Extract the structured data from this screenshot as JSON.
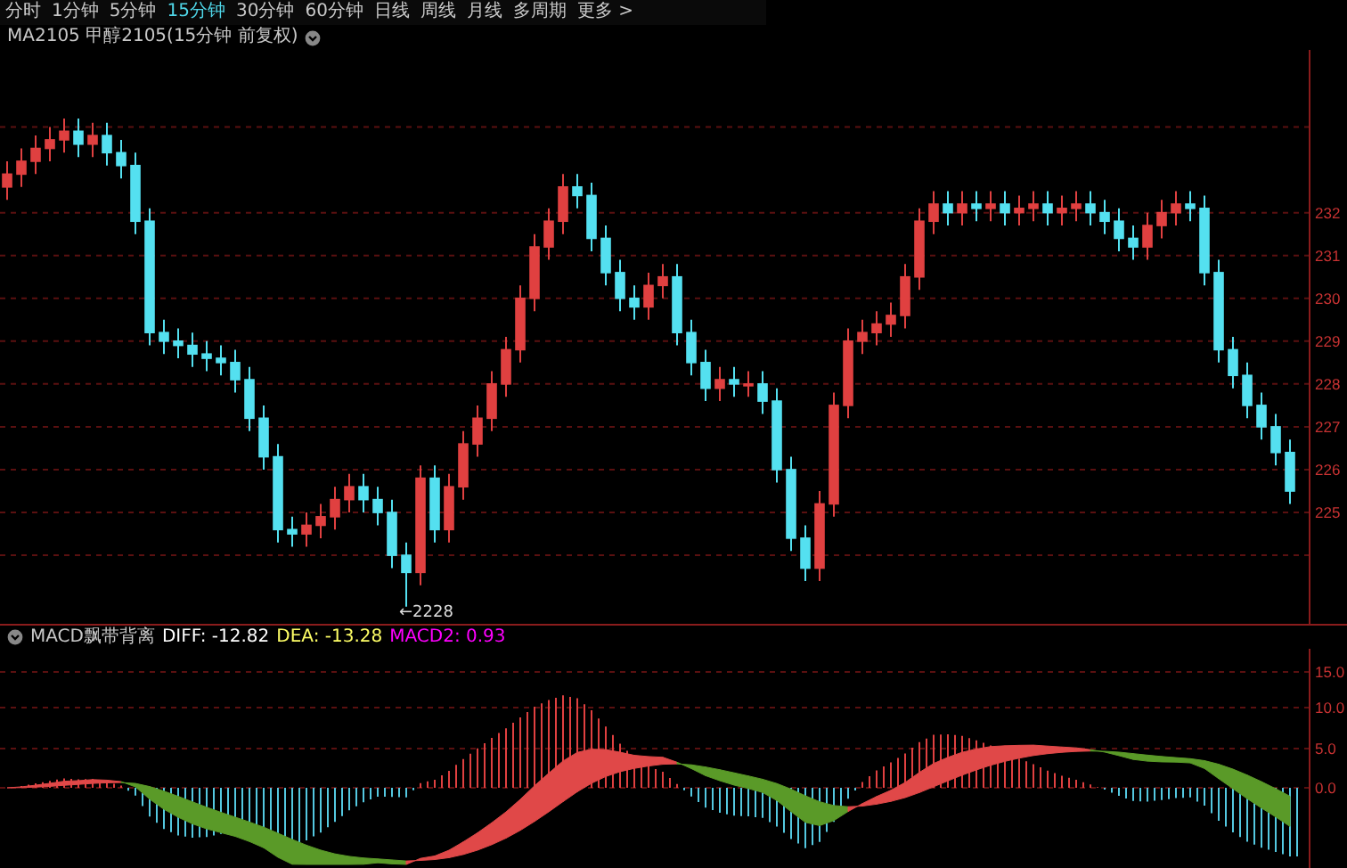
{
  "toolbar": {
    "tabs": [
      {
        "label": "分时",
        "selected": false
      },
      {
        "label": "1分钟",
        "selected": false
      },
      {
        "label": "5分钟",
        "selected": false
      },
      {
        "label": "15分钟",
        "selected": true
      },
      {
        "label": "30分钟",
        "selected": false
      },
      {
        "label": "60分钟",
        "selected": false
      },
      {
        "label": "日线",
        "selected": false
      },
      {
        "label": "周线",
        "selected": false
      },
      {
        "label": "月线",
        "selected": false
      },
      {
        "label": "多周期",
        "selected": false
      },
      {
        "label": "更多 >",
        "selected": false
      }
    ]
  },
  "title": "MA2105 甲醇2105(15分钟 前复权)",
  "price_chart": {
    "low_marker": "←2228",
    "chart_data": {
      "type": "candlestick",
      "ylim": [
        222.4,
        235.8
      ],
      "grid": true,
      "yticks": [
        232,
        231,
        230,
        229,
        228,
        227,
        226,
        225
      ],
      "categories": [
        null,
        null,
        null,
        null,
        null,
        null,
        null,
        null,
        null,
        null,
        null,
        null,
        null,
        null,
        null,
        null,
        null,
        null,
        null,
        null,
        null,
        null,
        null,
        null,
        null,
        null,
        null,
        null,
        null,
        null,
        null,
        null,
        null,
        null,
        null,
        null,
        null,
        null,
        null,
        null,
        null,
        null,
        null,
        null,
        null,
        null,
        null,
        null,
        null,
        null,
        null,
        null,
        null,
        null,
        null,
        null,
        null,
        null,
        null,
        null,
        null,
        null,
        null,
        null,
        null,
        null,
        null,
        null,
        null,
        null,
        null,
        null,
        null,
        null,
        null,
        null,
        null,
        null,
        null,
        null,
        null,
        null,
        null,
        null,
        null,
        null,
        null,
        null,
        null,
        null,
        null
      ],
      "ohlc": [
        [
          232.6,
          233.2,
          232.3,
          232.9
        ],
        [
          232.9,
          233.5,
          232.6,
          233.2
        ],
        [
          233.2,
          233.8,
          232.9,
          233.5
        ],
        [
          233.5,
          234.0,
          233.2,
          233.7
        ],
        [
          233.7,
          234.2,
          233.4,
          233.9
        ],
        [
          233.9,
          234.2,
          233.3,
          233.6
        ],
        [
          233.6,
          234.1,
          233.3,
          233.8
        ],
        [
          233.8,
          234.1,
          233.1,
          233.4
        ],
        [
          233.4,
          233.7,
          232.8,
          233.1
        ],
        [
          233.1,
          233.4,
          231.5,
          231.8
        ],
        [
          231.8,
          232.1,
          228.9,
          229.2
        ],
        [
          229.2,
          229.5,
          228.7,
          229.0
        ],
        [
          229.0,
          229.3,
          228.6,
          228.9
        ],
        [
          228.9,
          229.2,
          228.4,
          228.7
        ],
        [
          228.7,
          229.0,
          228.3,
          228.6
        ],
        [
          228.6,
          228.9,
          228.2,
          228.5
        ],
        [
          228.5,
          228.8,
          227.8,
          228.1
        ],
        [
          228.1,
          228.4,
          226.9,
          227.2
        ],
        [
          227.2,
          227.5,
          226.0,
          226.3
        ],
        [
          226.3,
          226.6,
          224.3,
          224.6
        ],
        [
          224.6,
          224.9,
          224.2,
          224.5
        ],
        [
          224.5,
          225.0,
          224.2,
          224.7
        ],
        [
          224.7,
          225.2,
          224.4,
          224.9
        ],
        [
          224.9,
          225.6,
          224.6,
          225.3
        ],
        [
          225.3,
          225.9,
          225.0,
          225.6
        ],
        [
          225.6,
          225.9,
          225.0,
          225.3
        ],
        [
          225.3,
          225.6,
          224.7,
          225.0
        ],
        [
          225.0,
          225.3,
          223.7,
          224.0
        ],
        [
          224.0,
          224.3,
          222.8,
          223.6
        ],
        [
          223.6,
          226.1,
          223.3,
          225.8
        ],
        [
          225.8,
          226.1,
          224.3,
          224.6
        ],
        [
          224.6,
          225.9,
          224.3,
          225.6
        ],
        [
          225.6,
          226.9,
          225.3,
          226.6
        ],
        [
          226.6,
          227.5,
          226.3,
          227.2
        ],
        [
          227.2,
          228.3,
          226.9,
          228.0
        ],
        [
          228.0,
          229.1,
          227.7,
          228.8
        ],
        [
          228.8,
          230.3,
          228.5,
          230.0
        ],
        [
          230.0,
          231.5,
          229.7,
          231.2
        ],
        [
          231.2,
          232.1,
          230.9,
          231.8
        ],
        [
          231.8,
          232.9,
          231.5,
          232.6
        ],
        [
          232.6,
          232.9,
          232.1,
          232.4
        ],
        [
          232.4,
          232.7,
          231.1,
          231.4
        ],
        [
          231.4,
          231.7,
          230.3,
          230.6
        ],
        [
          230.6,
          230.9,
          229.7,
          230.0
        ],
        [
          230.0,
          230.3,
          229.5,
          229.8
        ],
        [
          229.8,
          230.6,
          229.5,
          230.3
        ],
        [
          230.3,
          230.8,
          230.0,
          230.5
        ],
        [
          230.5,
          230.8,
          228.9,
          229.2
        ],
        [
          229.2,
          229.5,
          228.2,
          228.5
        ],
        [
          228.5,
          228.8,
          227.6,
          227.9
        ],
        [
          227.9,
          228.4,
          227.6,
          228.1
        ],
        [
          228.1,
          228.4,
          227.7,
          228.0
        ],
        [
          228.0,
          228.3,
          227.7,
          228.0
        ],
        [
          228.0,
          228.3,
          227.3,
          227.6
        ],
        [
          227.6,
          227.9,
          225.7,
          226.0
        ],
        [
          226.0,
          226.3,
          224.1,
          224.4
        ],
        [
          224.4,
          224.7,
          223.4,
          223.7
        ],
        [
          223.7,
          225.5,
          223.4,
          225.2
        ],
        [
          225.2,
          227.8,
          224.9,
          227.5
        ],
        [
          227.5,
          229.3,
          227.2,
          229.0
        ],
        [
          229.0,
          229.5,
          228.7,
          229.2
        ],
        [
          229.2,
          229.7,
          228.9,
          229.4
        ],
        [
          229.4,
          229.9,
          229.1,
          229.6
        ],
        [
          229.6,
          230.8,
          229.3,
          230.5
        ],
        [
          230.5,
          232.1,
          230.2,
          231.8
        ],
        [
          231.8,
          232.5,
          231.5,
          232.2
        ],
        [
          232.2,
          232.5,
          231.7,
          232.0
        ],
        [
          232.0,
          232.5,
          231.7,
          232.2
        ],
        [
          232.2,
          232.5,
          231.8,
          232.1
        ],
        [
          232.1,
          232.5,
          231.8,
          232.2
        ],
        [
          232.2,
          232.5,
          231.7,
          232.0
        ],
        [
          232.0,
          232.4,
          231.7,
          232.1
        ],
        [
          232.1,
          232.5,
          231.8,
          232.2
        ],
        [
          232.2,
          232.5,
          231.7,
          232.0
        ],
        [
          232.0,
          232.4,
          231.7,
          232.1
        ],
        [
          232.1,
          232.5,
          231.8,
          232.2
        ],
        [
          232.2,
          232.5,
          231.7,
          232.0
        ],
        [
          232.0,
          232.3,
          231.5,
          231.8
        ],
        [
          231.8,
          232.1,
          231.1,
          231.4
        ],
        [
          231.4,
          231.7,
          230.9,
          231.2
        ],
        [
          231.2,
          232.0,
          230.9,
          231.7
        ],
        [
          231.7,
          232.3,
          231.4,
          232.0
        ],
        [
          232.0,
          232.5,
          231.7,
          232.2
        ],
        [
          232.2,
          232.5,
          231.8,
          232.1
        ],
        [
          232.1,
          232.4,
          230.3,
          230.6
        ],
        [
          230.6,
          230.9,
          228.5,
          228.8
        ],
        [
          228.8,
          229.1,
          227.9,
          228.2
        ],
        [
          228.2,
          228.5,
          227.2,
          227.5
        ],
        [
          227.5,
          227.8,
          226.7,
          227.0
        ],
        [
          227.0,
          227.3,
          226.1,
          226.4
        ],
        [
          226.4,
          226.7,
          225.2,
          225.5
        ]
      ]
    }
  },
  "macd": {
    "name": "MACD飘带背离",
    "indicators": [
      {
        "label": "DIFF: -12.82",
        "color": "#ffffff"
      },
      {
        "label": "DEA: -13.28",
        "color": "#ffff66"
      },
      {
        "label": "MACD2: 0.93",
        "color": "#ff00ff"
      }
    ],
    "axis_labels": [
      "15.0",
      "10.0",
      "5.0",
      "0.0"
    ]
  }
}
